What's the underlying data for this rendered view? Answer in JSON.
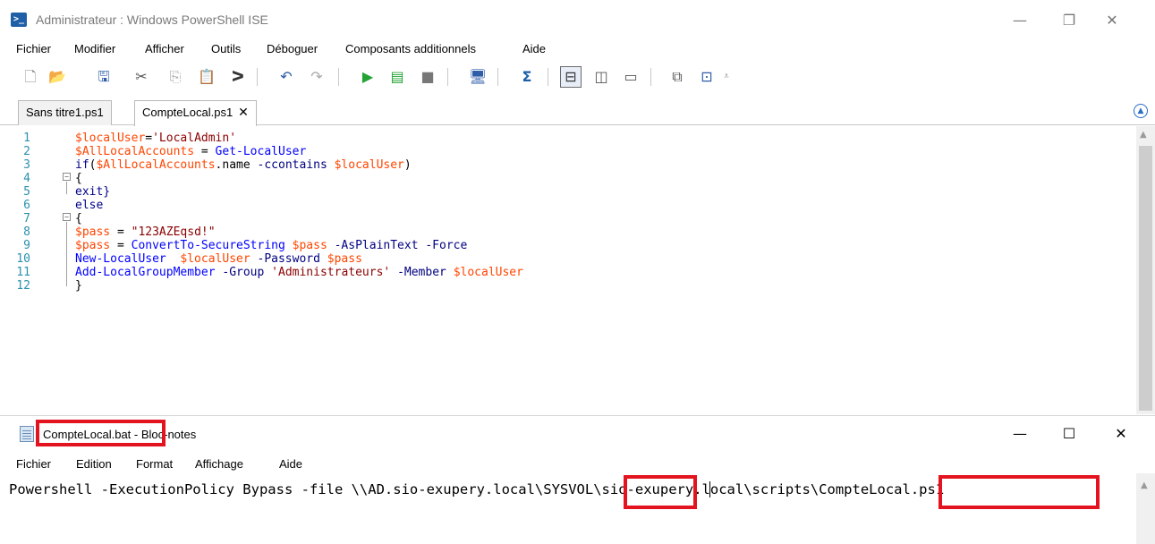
{
  "ise": {
    "title": "Administrateur : Windows PowerShell ISE",
    "window_controls": {
      "minimize": "—",
      "restore": "❐",
      "close": "✕"
    },
    "menu": [
      "Fichier",
      "Modifier",
      "Afficher",
      "Outils",
      "Déboguer",
      "Composants additionnels",
      "Aide"
    ],
    "toolbar_icons": [
      "new-script-icon",
      "open-folder-icon",
      "save-icon",
      "cut-icon",
      "copy-icon",
      "paste-icon",
      "clear-console-icon",
      "undo-icon",
      "redo-icon",
      "run-script-icon",
      "run-selection-icon",
      "stop-icon",
      "remote-powershell-icon",
      "start-powershell-icon",
      "show-script-pane-top-icon",
      "show-script-pane-right-icon",
      "show-script-pane-max-icon",
      "show-command-window-icon",
      "show-command-addon-icon",
      "customize-toolbar-icon"
    ],
    "tabs": [
      {
        "label": "Sans titre1.ps1",
        "active": false
      },
      {
        "label": "CompteLocal.ps1",
        "active": true,
        "close": "✕"
      }
    ],
    "line_numbers": [
      "1",
      "2",
      "3",
      "4",
      "5",
      "6",
      "7",
      "8",
      "9",
      "10",
      "11",
      "12"
    ],
    "code": {
      "l1_var": "$localUser",
      "l1_eq": "=",
      "l1_str": "'LocalAdmin'",
      "l2_var": "$AllLocalAccounts",
      "l2_eq": " = ",
      "l2_cmd": "Get-LocalUser",
      "l3_kw": "if",
      "l3_open": "(",
      "l3_var": "$AllLocalAccounts",
      "l3_member": ".name ",
      "l3_op": "-ccontains ",
      "l3_var2": "$localUser",
      "l3_close": ")",
      "l4": "{",
      "l5": "exit}",
      "l6": "else",
      "l7": "{",
      "l8_var": "$pass",
      "l8_eq": " = ",
      "l8_str": "\"123AZEqsd!\"",
      "l9_var": "$pass",
      "l9_eq": " = ",
      "l9_cmd": "ConvertTo-SecureString ",
      "l9_var2": "$pass ",
      "l9_p1": "-AsPlainText ",
      "l9_p2": "-Force",
      "l10_cmd": "New-LocalUser  ",
      "l10_var": "$localUser ",
      "l10_p": "-Password ",
      "l10_var2": "$pass",
      "l11_cmd": "Add-LocalGroupMember ",
      "l11_p1": "-Group ",
      "l11_str": "'Administrateurs' ",
      "l11_p2": "-Member ",
      "l11_var": "$localUser",
      "l12": "}"
    },
    "fold_symbol": "−"
  },
  "notepad": {
    "title": "CompteLocal.bat - Bloc-notes",
    "window_controls": {
      "minimize": "—",
      "maximize": "☐",
      "close": "✕"
    },
    "menu": [
      "Fichier",
      "Edition",
      "Format",
      "Affichage",
      "Aide"
    ],
    "content": "Powershell -ExecutionPolicy Bypass -file \\\\AD.sio-exupery.local\\SYSVOL\\sio-exupery.local\\scripts\\CompteLocal.ps1"
  },
  "colors": {
    "highlight": "#e3141f",
    "variable": "#ff4500",
    "string": "#8b0000",
    "cmdlet": "#0000ff",
    "parameter": "#000080",
    "line_number": "#2b91af"
  }
}
